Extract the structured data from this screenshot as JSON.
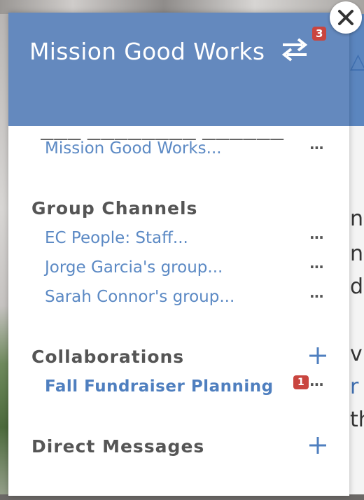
{
  "header": {
    "title": "Mission Good Works",
    "swap_badge": "3"
  },
  "background_chars": {
    "c1": "△",
    "c2": "n",
    "c3": "n",
    "c4": "d",
    "c5": "v",
    "c6": "r",
    "c7": "th"
  },
  "top_section": {
    "items": [
      {
        "label": "Mission Good Works...",
        "menu": "..."
      }
    ]
  },
  "group_channels": {
    "heading": "Group Channels",
    "items": [
      {
        "label": "EC People: Staff...",
        "menu": "..."
      },
      {
        "label": "Jorge Garcia's group...",
        "menu": "..."
      },
      {
        "label": "Sarah Connor's group...",
        "menu": "..."
      }
    ]
  },
  "collaborations": {
    "heading": "Collaborations",
    "items": [
      {
        "label": "Fall Fundraiser Planning",
        "badge": "1",
        "menu": "..."
      }
    ]
  },
  "direct_messages": {
    "heading": "Direct Messages"
  },
  "colors": {
    "header_bg": "#6489be",
    "link": "#5b89c4",
    "badge": "#c9453f"
  }
}
